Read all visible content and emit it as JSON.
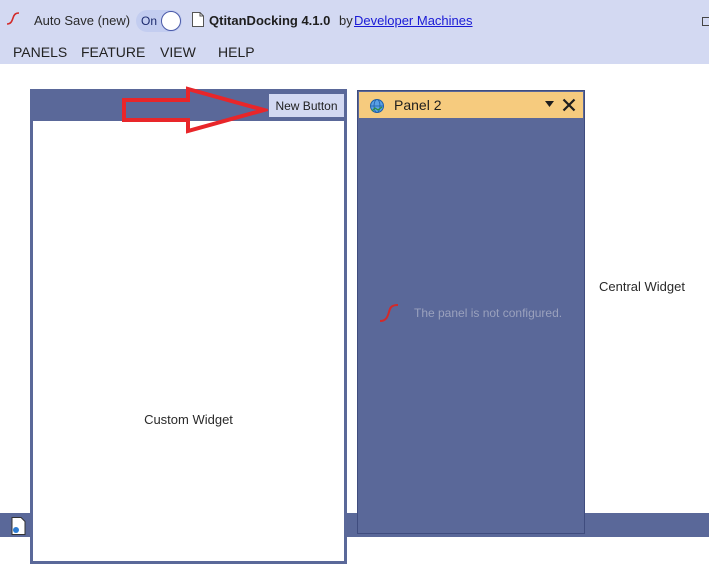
{
  "titlebar": {
    "autosave_label": "Auto Save (new)",
    "toggle_state": "On",
    "doc_title": "QtitanDocking 4.1.0",
    "by_text": "by",
    "vendor_link": "Developer Machines"
  },
  "menu": {
    "items": [
      "PANELS",
      "FEATURE",
      "VIEW",
      "HELP"
    ]
  },
  "panel1": {
    "new_button_label": "New Button",
    "body_label": "Custom Widget",
    "arrow_color": "#e8262a"
  },
  "panel2": {
    "title": "Panel 2",
    "message": "The panel is not configured."
  },
  "central": {
    "label": "Central Widget"
  },
  "colors": {
    "titlebar_bg": "#d3d9f2",
    "panel_bg": "#5a6899",
    "active_header": "#f6cb7e",
    "link": "#1a1ad6"
  },
  "icons": {
    "app_logo": "qtitan-logo-icon",
    "document": "document-icon",
    "globe": "globe-icon",
    "dropdown": "chevron-down-icon",
    "close": "close-icon",
    "restore": "restore-icon"
  }
}
